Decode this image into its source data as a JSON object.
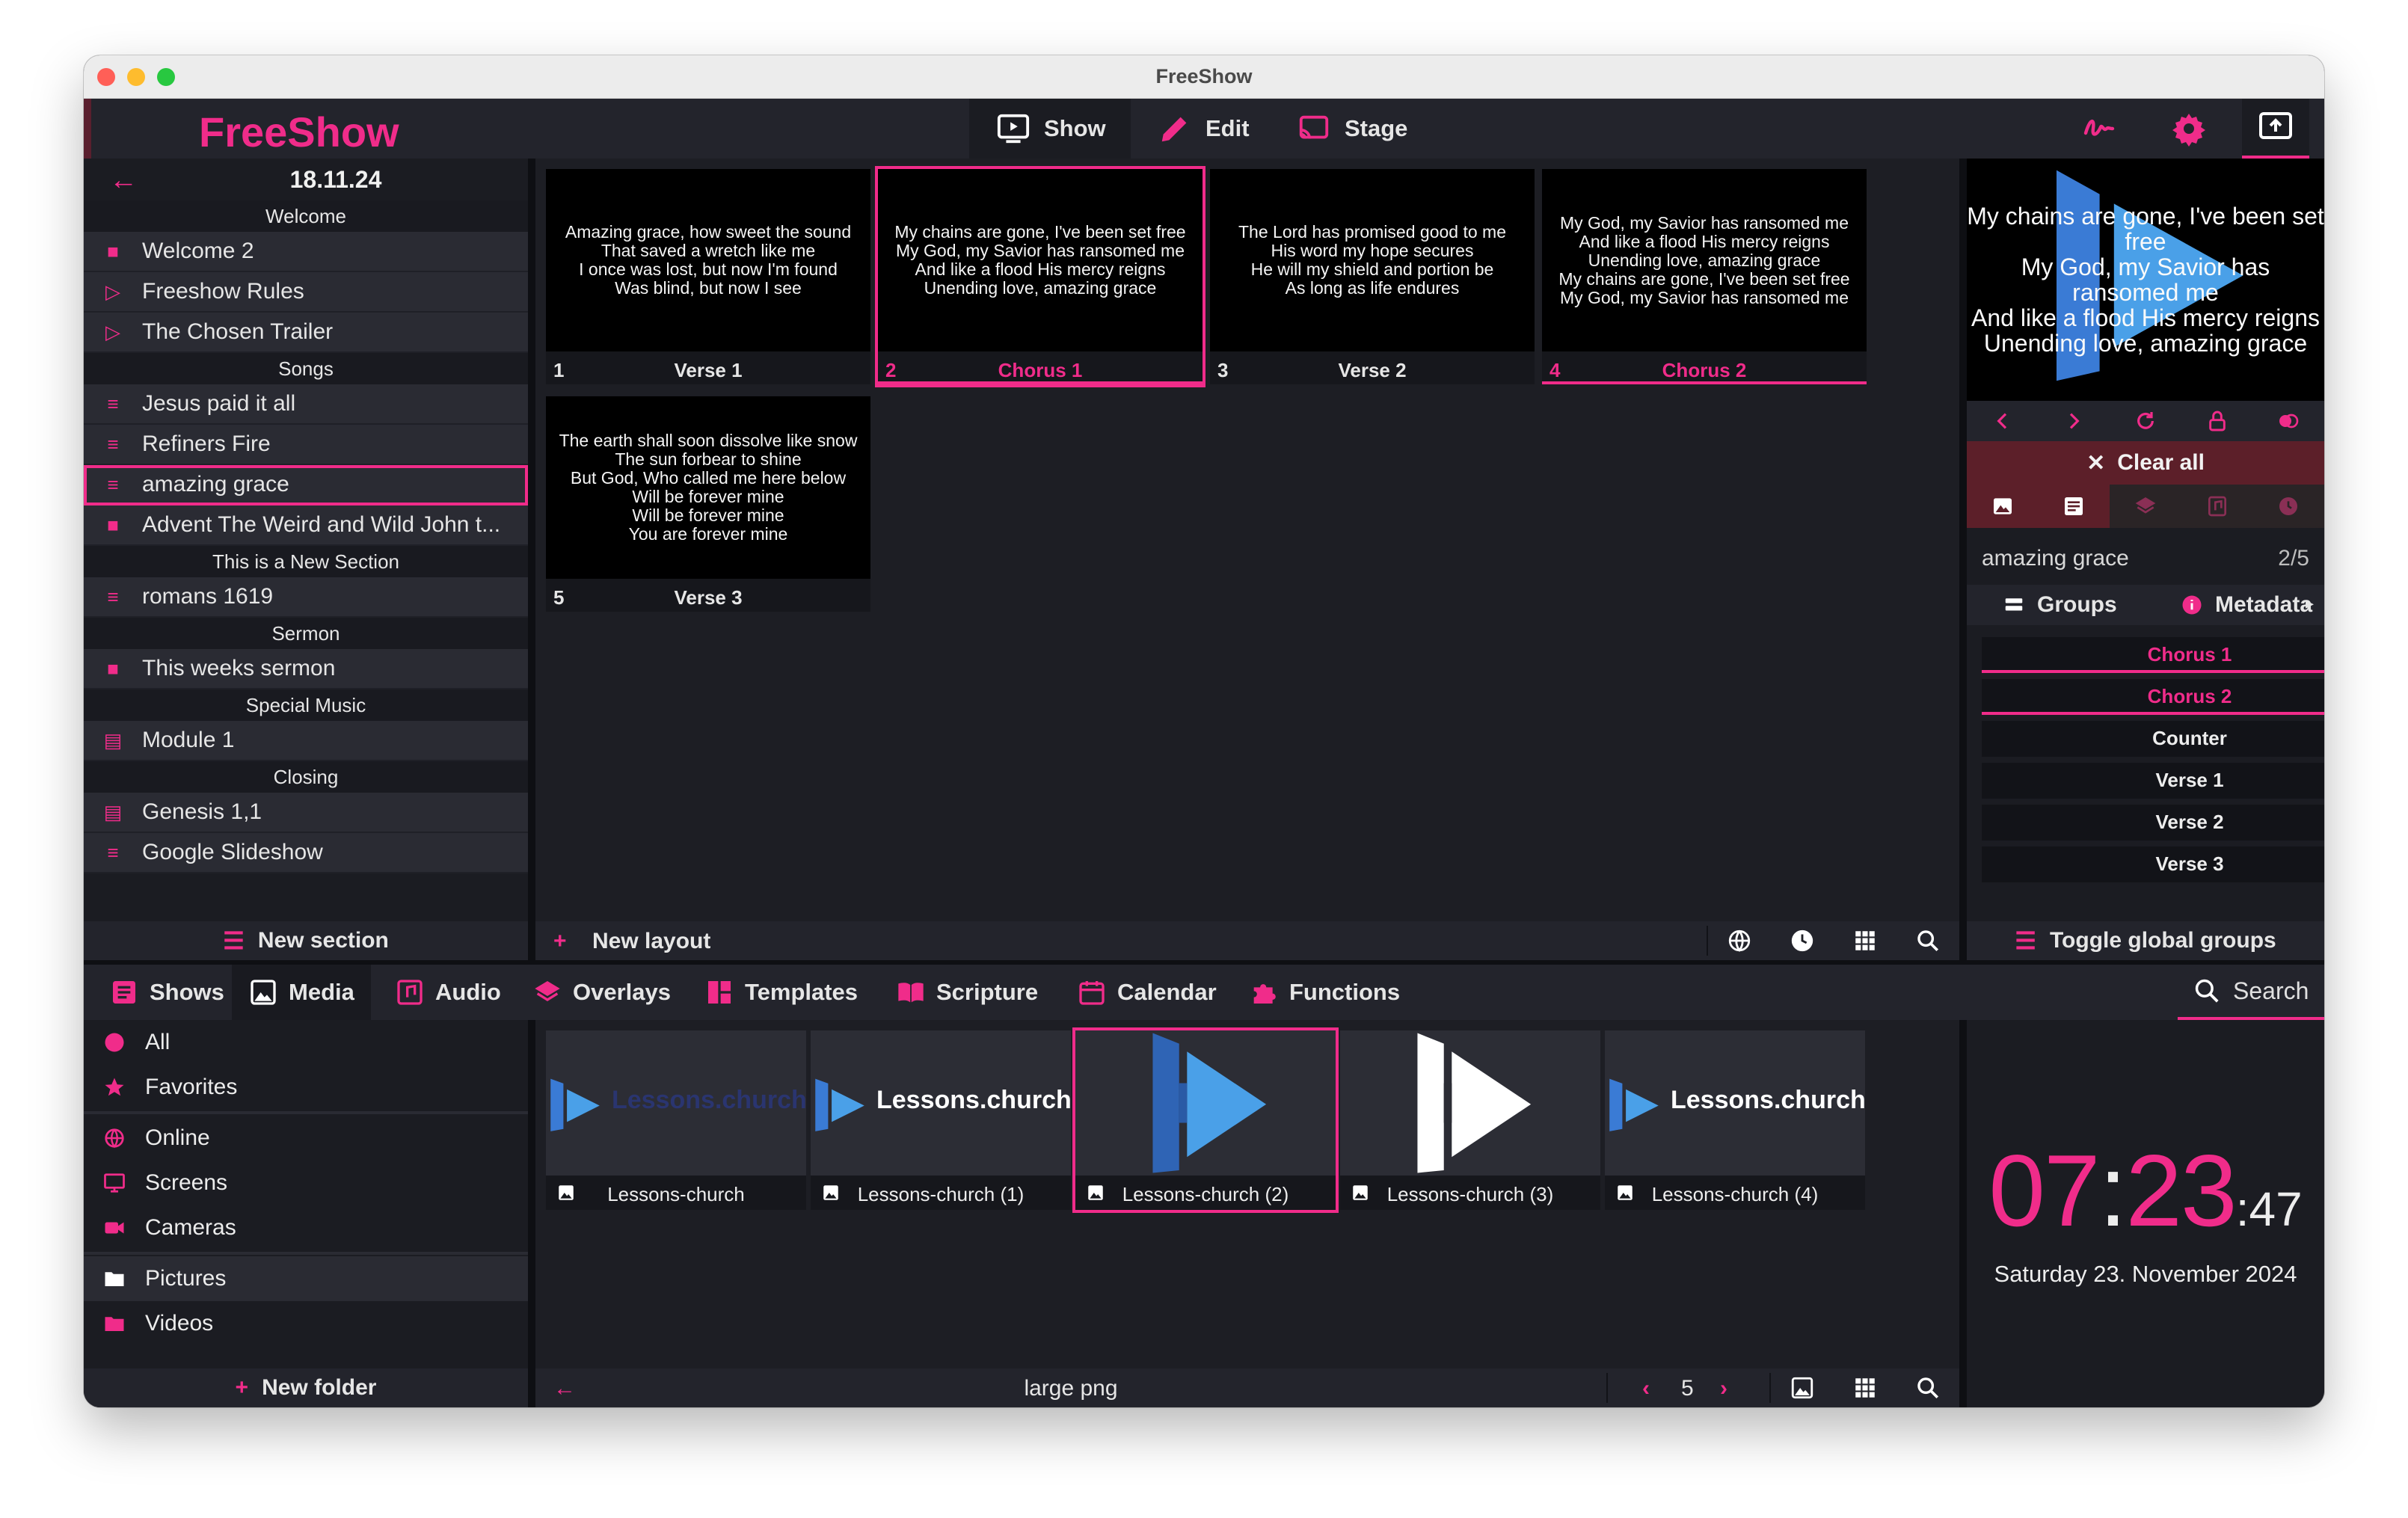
{
  "window": {
    "title": "FreeShow"
  },
  "app": {
    "logo": "FreeShow"
  },
  "top_tabs": [
    {
      "label": "Show",
      "icon": "play-screen-icon"
    },
    {
      "label": "Edit",
      "icon": "pencil-icon"
    },
    {
      "label": "Stage",
      "icon": "cast-icon"
    }
  ],
  "top_right_icons": [
    "signature-icon",
    "gear-icon",
    "output-screen-icon"
  ],
  "project": {
    "date": "18.11.24",
    "items": [
      {
        "type": "section",
        "label": "Welcome"
      },
      {
        "type": "item",
        "label": "Welcome 2",
        "icon": "document-icon"
      },
      {
        "type": "item",
        "label": "Freeshow Rules",
        "icon": "presentation-icon"
      },
      {
        "type": "item",
        "label": "The Chosen Trailer",
        "icon": "presentation-icon"
      },
      {
        "type": "section",
        "label": "Songs"
      },
      {
        "type": "item",
        "label": "Jesus paid it all",
        "icon": "song-list-icon"
      },
      {
        "type": "item",
        "label": "Refiners Fire",
        "icon": "song-list-icon"
      },
      {
        "type": "item",
        "label": "amazing grace",
        "icon": "song-list-icon",
        "selected": true
      },
      {
        "type": "item",
        "label": "Advent The Weird and Wild John t...",
        "icon": "document-icon"
      },
      {
        "type": "section",
        "label": "This is a New Section"
      },
      {
        "type": "item",
        "label": "romans 1619",
        "icon": "song-list-icon"
      },
      {
        "type": "section",
        "label": "Sermon"
      },
      {
        "type": "item",
        "label": "This weeks sermon",
        "icon": "document-icon"
      },
      {
        "type": "section",
        "label": "Special Music"
      },
      {
        "type": "item",
        "label": "Module 1",
        "icon": "book-icon"
      },
      {
        "type": "section",
        "label": "Closing"
      },
      {
        "type": "item",
        "label": "Genesis 1,1",
        "icon": "book-icon"
      },
      {
        "type": "item",
        "label": "Google Slideshow",
        "icon": "song-list-icon"
      }
    ],
    "new_section": "New section"
  },
  "slides": [
    {
      "num": "1",
      "name": "Verse 1",
      "lines": [
        "Amazing grace, how sweet the sound",
        "That saved a wretch like me",
        "I once was lost, but now I'm found",
        "Was blind, but now I see"
      ]
    },
    {
      "num": "2",
      "name": "Chorus 1",
      "lines": [
        "My chains are gone, I've been set free",
        "My God, my Savior has ransomed me",
        "And like a flood His mercy reigns",
        "Unending love, amazing grace"
      ],
      "pink": true,
      "active": true
    },
    {
      "num": "3",
      "name": "Verse 2",
      "lines": [
        "The Lord has promised good to me",
        "His word my hope secures",
        "He will my shield and portion be",
        "As long as life endures"
      ]
    },
    {
      "num": "4",
      "name": "Chorus 2",
      "lines": [
        "My God, my Savior has ransomed me",
        "And like a flood His mercy reigns",
        "Unending love, amazing grace",
        "My chains are gone, I've been set free",
        "My God, my Savior has ransomed me"
      ],
      "pink": true
    },
    {
      "num": "5",
      "name": "Verse 3",
      "lines": [
        "The earth shall soon dissolve like snow",
        "The sun forbear to shine",
        "But God, Who called me here below",
        "Will be forever mine",
        "Will be forever mine",
        "You are forever mine"
      ]
    }
  ],
  "layout_footer": {
    "new_layout": "New layout",
    "icons": [
      "globe-icon",
      "clock-icon",
      "grid-icon",
      "zoom-icon"
    ]
  },
  "output": {
    "preview_lines": [
      "My chains are gone, I've been set free",
      "My God, my Savior has ransomed me",
      "And like a flood His mercy reigns",
      "Unending love, amazing grace"
    ],
    "controls": [
      "chevron-left-icon",
      "chevron-right-icon",
      "refresh-icon",
      "lock-icon",
      "toggle-icon"
    ],
    "clear_all": "Clear all",
    "clear_tabs": [
      "background-image-icon",
      "slide-text-icon",
      "layers-icon",
      "audio-file-icon",
      "timer-icon"
    ],
    "show_name": "amazing grace",
    "slide_count": "2/5"
  },
  "groups_panel": {
    "tabs": [
      {
        "label": "Groups",
        "icon": "list-icon"
      },
      {
        "label": "Metadata",
        "icon": "info-icon"
      }
    ],
    "items": [
      {
        "label": "Chorus 1",
        "pink": true
      },
      {
        "label": "Chorus 2",
        "pink": true
      },
      {
        "label": "Counter"
      },
      {
        "label": "Verse 1"
      },
      {
        "label": "Verse 2"
      },
      {
        "label": "Verse 3"
      }
    ],
    "toggle_global": "Toggle global groups"
  },
  "drawer": {
    "tabs": [
      {
        "label": "Shows",
        "icon": "shows-icon"
      },
      {
        "label": "Media",
        "icon": "image-icon",
        "active": true
      },
      {
        "label": "Audio",
        "icon": "music-icon"
      },
      {
        "label": "Overlays",
        "icon": "layers-icon"
      },
      {
        "label": "Templates",
        "icon": "template-icon"
      },
      {
        "label": "Scripture",
        "icon": "book-icon"
      },
      {
        "label": "Calendar",
        "icon": "calendar-icon"
      },
      {
        "label": "Functions",
        "icon": "puzzle-icon"
      }
    ],
    "search": "Search"
  },
  "media_nav": [
    {
      "label": "All",
      "icon": "circle-icon"
    },
    {
      "label": "Favorites",
      "icon": "star-icon"
    },
    {
      "label": "Online",
      "icon": "globe-icon"
    },
    {
      "label": "Screens",
      "icon": "monitor-icon"
    },
    {
      "label": "Cameras",
      "icon": "camera-icon"
    },
    {
      "label": "Pictures",
      "icon": "folder-icon",
      "hl": true
    },
    {
      "label": "Videos",
      "icon": "folder-icon"
    }
  ],
  "new_folder": "New folder",
  "media_items": [
    {
      "name": "Lessons-church",
      "wordmark": "Lessons.church",
      "variant": "dark-text"
    },
    {
      "name": "Lessons-church (1)",
      "wordmark": "Lessons.church",
      "variant": "white-text"
    },
    {
      "name": "Lessons-church (2)",
      "wordmark": "",
      "variant": "big-blue",
      "active": true
    },
    {
      "name": "Lessons-church (3)",
      "wordmark": "",
      "variant": "big-white"
    },
    {
      "name": "Lessons-church (4)",
      "wordmark": "Lessons.church",
      "variant": "white-text"
    }
  ],
  "media_footer": {
    "folder": "large png",
    "page": "5"
  },
  "clock": {
    "hours": "07",
    "minutes": "23",
    "seconds": "47",
    "date": "Saturday 23. November 2024"
  },
  "colors": {
    "accent": "#f02c8a",
    "panel": "#1b1c22",
    "bar": "#23242c",
    "logo_blue": "#3a7bd5"
  }
}
